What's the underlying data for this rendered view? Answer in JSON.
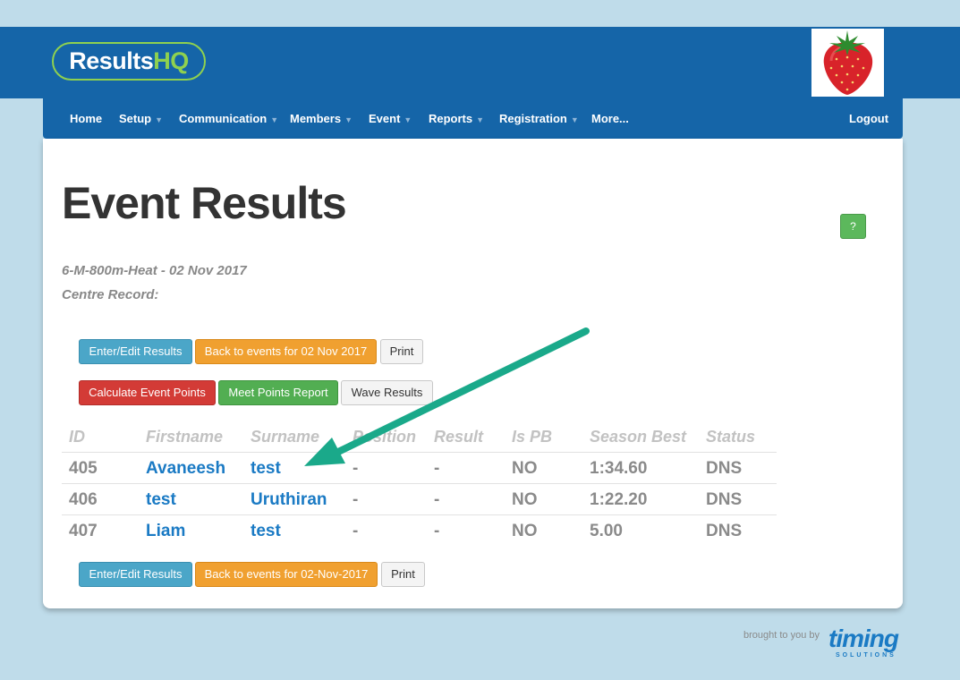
{
  "header": {
    "logo_part1": "Results",
    "logo_part2": "HQ"
  },
  "nav": {
    "items": [
      "Home",
      "Setup",
      "Communication",
      "Members",
      "Event",
      "Reports",
      "Registration",
      "More..."
    ],
    "logout": "Logout"
  },
  "page": {
    "title": "Event Results",
    "help_label": "?",
    "event_line": "6-M-800m-Heat - 02 Nov 2017",
    "record_line": "Centre Record:"
  },
  "buttons": {
    "enter_edit": "Enter/Edit Results",
    "back_events_top": "Back to events for 02 Nov 2017",
    "print": "Print",
    "calc_points": "Calculate Event Points",
    "meet_points": "Meet Points Report",
    "wave_results": "Wave Results",
    "back_events_bottom": "Back to events for 02-Nov-2017"
  },
  "table": {
    "headers": [
      "ID",
      "Firstname",
      "Surname",
      "Position",
      "Result",
      "Is PB",
      "Season Best",
      "Status"
    ],
    "rows": [
      [
        "405",
        "Avaneesh",
        "test",
        "-",
        "-",
        "NO",
        "1:34.60",
        "DNS"
      ],
      [
        "406",
        "test",
        "Uruthiran",
        "-",
        "-",
        "NO",
        "1:22.20",
        "DNS"
      ],
      [
        "407",
        "Liam",
        "test",
        "-",
        "-",
        "NO",
        "5.00",
        "DNS"
      ]
    ]
  },
  "footer": {
    "brought_by": "brought to you by",
    "brand": "timing",
    "brand_sub": "SOLUTIONS"
  },
  "colors": {
    "primary": "#1565a8",
    "accent_green": "#8fd14f",
    "arrow": "#1aa98a"
  }
}
